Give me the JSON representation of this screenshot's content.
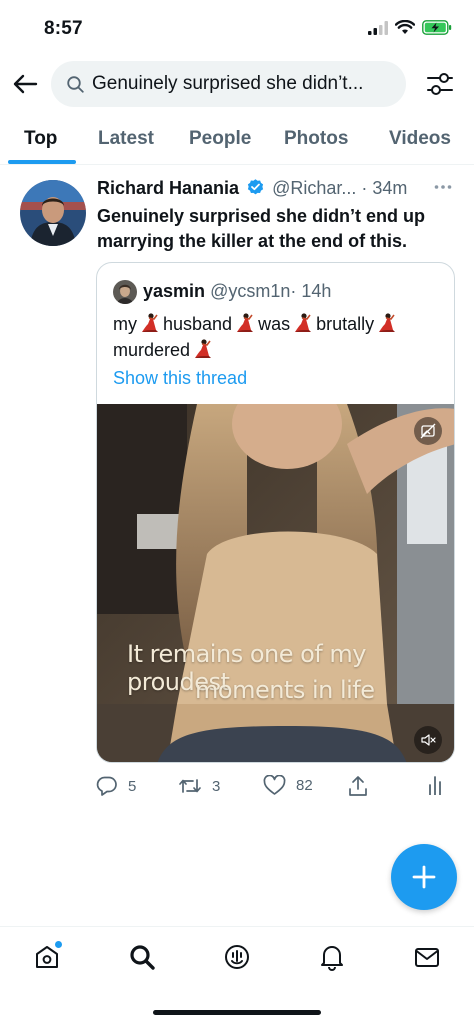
{
  "status_bar": {
    "time": "8:57"
  },
  "search": {
    "query": "Genuinely surprised she didn’t..."
  },
  "tabs": [
    {
      "label": "Top"
    },
    {
      "label": "Latest"
    },
    {
      "label": "People"
    },
    {
      "label": "Photos"
    },
    {
      "label": "Videos"
    }
  ],
  "tweet": {
    "author_name": "Richard Hanania",
    "handle": "@Richar...",
    "dot": "·",
    "time": "34m",
    "text": "Genuinely surprised she didn’t end up marrying the killer at the end of this.",
    "quote": {
      "author_name": "yasmin",
      "handle": "@ycsm1n",
      "dot": "·",
      "time": "14h",
      "words": [
        "my",
        "husband",
        "was",
        "brutally",
        "murdered"
      ],
      "show_thread": "Show this thread",
      "caption_line1": "It remains one of my proudest",
      "caption_line2": "moments in life"
    },
    "stats": {
      "replies": "5",
      "retweets": "3",
      "likes": "82"
    }
  },
  "colors": {
    "accent": "#1d9bf0",
    "text": "#0f1419",
    "secondary": "#536471"
  },
  "icons": [
    "back-arrow-icon",
    "search-icon",
    "filter-icon",
    "verified-badge-icon",
    "more-icon",
    "reply-icon",
    "retweet-icon",
    "like-icon",
    "share-icon",
    "analytics-icon",
    "compose-icon",
    "home-icon",
    "explore-icon",
    "spaces-icon",
    "notifications-icon",
    "messages-icon",
    "mute-icon",
    "sensitive-media-icon",
    "flamenco-dancer-emoji"
  ]
}
